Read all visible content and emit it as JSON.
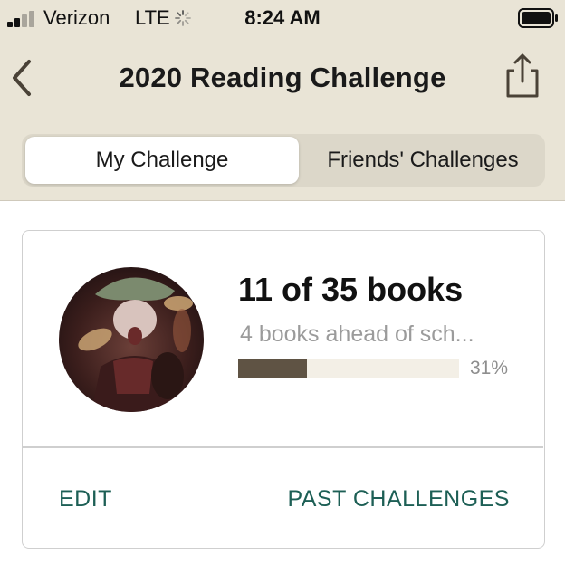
{
  "status_bar": {
    "carrier": "Verizon",
    "network": "LTE",
    "time": "8:24 AM",
    "icons": [
      "signal-icon",
      "loading-spinner-icon",
      "battery-icon"
    ]
  },
  "nav": {
    "title": "2020 Reading Challenge",
    "icons": [
      "back-chevron-icon",
      "share-icon"
    ]
  },
  "tabs": [
    {
      "label": "My Challenge",
      "selected": true
    },
    {
      "label": "Friends' Challenges",
      "selected": false
    }
  ],
  "challenge": {
    "books_count": "11 of 35 books",
    "schedule_status": "4 books ahead of sch...",
    "progress_fraction": 0.31,
    "progress_label": "31%",
    "actions": {
      "edit": "EDIT",
      "past": "PAST CHALLENGES"
    }
  },
  "colors": {
    "header_bg": "#e9e4d6",
    "accent_link": "#1d5f55",
    "progress_fill": "#5f5344",
    "progress_track": "#f3efe6"
  }
}
